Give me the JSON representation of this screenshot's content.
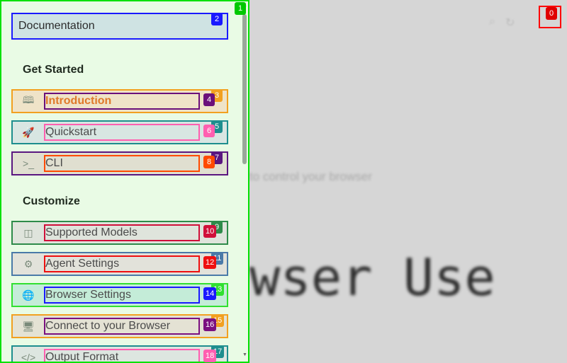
{
  "background": {
    "subtitle": "to control your browser",
    "hero": "wser Use"
  },
  "sidebar": {
    "doc_button": "Documentation",
    "sections": [
      {
        "title": "Get Started",
        "items": [
          {
            "label": "Introduction",
            "icon": "book-icon",
            "active": true
          },
          {
            "label": "Quickstart",
            "icon": "rocket-icon"
          },
          {
            "label": "CLI",
            "icon": "terminal-icon"
          }
        ]
      },
      {
        "title": "Customize",
        "items": [
          {
            "label": "Supported Models",
            "icon": "robot-icon"
          },
          {
            "label": "Agent Settings",
            "icon": "gear-icon"
          },
          {
            "label": "Browser Settings",
            "icon": "globe-icon"
          },
          {
            "label": "Connect to your Browser",
            "icon": "monitor-icon"
          },
          {
            "label": "Output Format",
            "icon": "code-icon"
          }
        ]
      }
    ]
  },
  "tags": [
    "0",
    "1",
    "2",
    "3",
    "4",
    "5",
    "6",
    "7",
    "8",
    "9",
    "10",
    "11",
    "12",
    "13",
    "14",
    "15",
    "16",
    "17",
    "18"
  ],
  "colors": {
    "sidebar_border": "#00e000",
    "sidebar_bg": "#e9fbe5",
    "active_text": "#e0792a",
    "close_border": "#ff0000"
  }
}
